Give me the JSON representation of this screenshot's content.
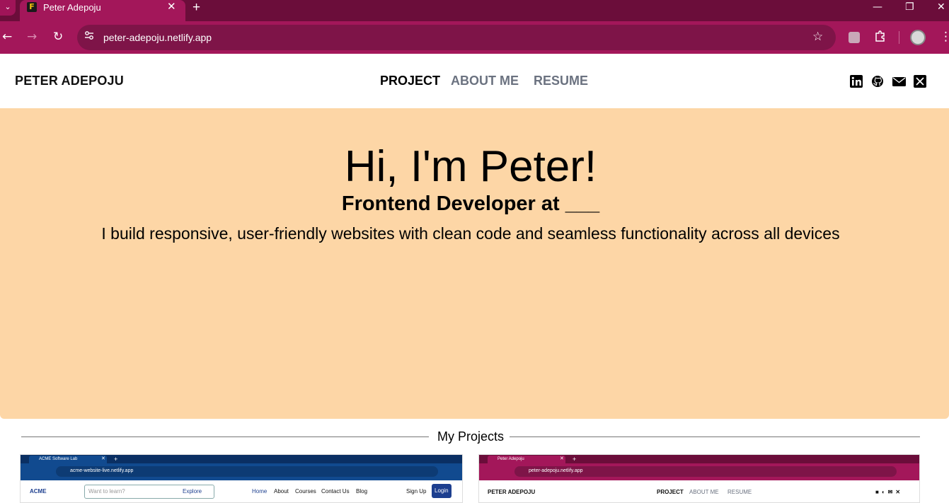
{
  "browser": {
    "tab_title": "Peter Adepoju",
    "tab_close": "✕",
    "new_tab": "+",
    "tab_menu": "⌄",
    "url": "peter-adepoju.netlify.app",
    "win_minimize": "—",
    "win_restore": "❐",
    "win_close": "✕",
    "colors": {
      "frame": "#6b0d3a",
      "toolbar": "#a3175a",
      "omnibox": "#7e1448"
    }
  },
  "site": {
    "brand": "PETER ADEPOJU",
    "menu": [
      "PROJECT",
      "ABOUT ME",
      "RESUME"
    ],
    "socials": [
      "linkedin-icon",
      "github-icon",
      "mail-icon",
      "x-icon"
    ]
  },
  "hero": {
    "title": "Hi, I'm Peter!",
    "subtitle": "Frontend Developer at ___",
    "description": "I build responsive, user-friendly websites with clean code and seamless functionality across all devices",
    "background": "#fdd6a6"
  },
  "projects": {
    "heading": "My Projects",
    "items": [
      {
        "tab_title": "ACME Software Lab",
        "url": "acme-website-live.netlify.app",
        "brand": "ACME",
        "search_placeholder": "Want to learn?",
        "explore": "Explore",
        "links": [
          "Home",
          "About",
          "Courses",
          "Contact Us",
          "Blog"
        ],
        "signup": "Sign Up",
        "login": "Login"
      },
      {
        "tab_title": "Peter Adepoju",
        "url": "peter-adepoju.netlify.app",
        "brand": "PETER ADEPOJU",
        "links": [
          "PROJECT",
          "ABOUT ME",
          "RESUME"
        ]
      }
    ]
  }
}
